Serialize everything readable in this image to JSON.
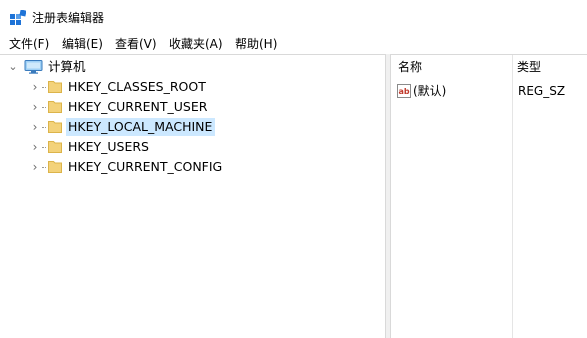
{
  "window": {
    "title": "注册表编辑器",
    "icon": "registry-editor-icon"
  },
  "menu": {
    "items": [
      "文件(F)",
      "编辑(E)",
      "查看(V)",
      "收藏夹(A)",
      "帮助(H)"
    ]
  },
  "tree": {
    "root": {
      "label": "计算机",
      "icon": "computer-icon",
      "expanded": true
    },
    "keys": [
      {
        "label": "HKEY_CLASSES_ROOT",
        "selected": false
      },
      {
        "label": "HKEY_CURRENT_USER",
        "selected": false
      },
      {
        "label": "HKEY_LOCAL_MACHINE",
        "selected": true
      },
      {
        "label": "HKEY_USERS",
        "selected": false
      },
      {
        "label": "HKEY_CURRENT_CONFIG",
        "selected": false
      }
    ]
  },
  "list": {
    "columns": [
      "名称",
      "类型"
    ],
    "rows": [
      {
        "name": "(默认)",
        "type": "REG_SZ",
        "icon": "string-value-icon"
      }
    ]
  },
  "colors": {
    "selection": "#cce8ff",
    "folder": "#f3d27a",
    "folder_outline": "#dcb44a",
    "registry_blue": "#1e73d7"
  }
}
